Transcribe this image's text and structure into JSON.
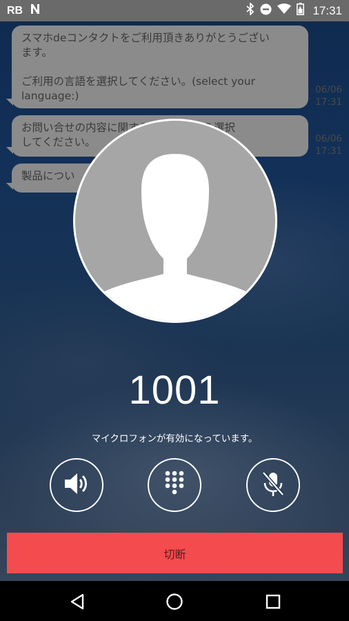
{
  "status_bar": {
    "carrier": "RB",
    "time": "17:31",
    "icons": [
      "n-notification-icon",
      "bluetooth-icon",
      "do-not-disturb-icon",
      "wifi-icon",
      "battery-icon"
    ]
  },
  "chat": {
    "messages": [
      {
        "text_lines": [
          "スマホdeコンタクトをご利用頂きありがとうござい",
          "ます。",
          "",
          "ご利用の言語を選択してください。(select your",
          "language:)"
        ],
        "time_date": "06/06",
        "time_clock": "17:31"
      },
      {
        "text_lines": [
          "お問い合せの内容に関するメニューから選択",
          "してください。"
        ],
        "time_date": "06/06",
        "time_clock": "17:31"
      },
      {
        "text_lines": [
          "製品につい"
        ]
      }
    ]
  },
  "call": {
    "number": "1001",
    "status": "マイクロフォンが有効になっています。",
    "controls": [
      {
        "name": "speaker",
        "icon": "speaker-icon"
      },
      {
        "name": "dialpad",
        "icon": "dialpad-icon"
      },
      {
        "name": "mute",
        "icon": "microphone-off-icon"
      }
    ],
    "hangup_label": "切断"
  },
  "colors": {
    "hangup": "#f44b4e",
    "bubble": "#8b8b8b",
    "status_bar": "#6a6a6a"
  },
  "nav_bar": {
    "icons": [
      "back-icon",
      "home-icon",
      "recents-icon"
    ]
  }
}
